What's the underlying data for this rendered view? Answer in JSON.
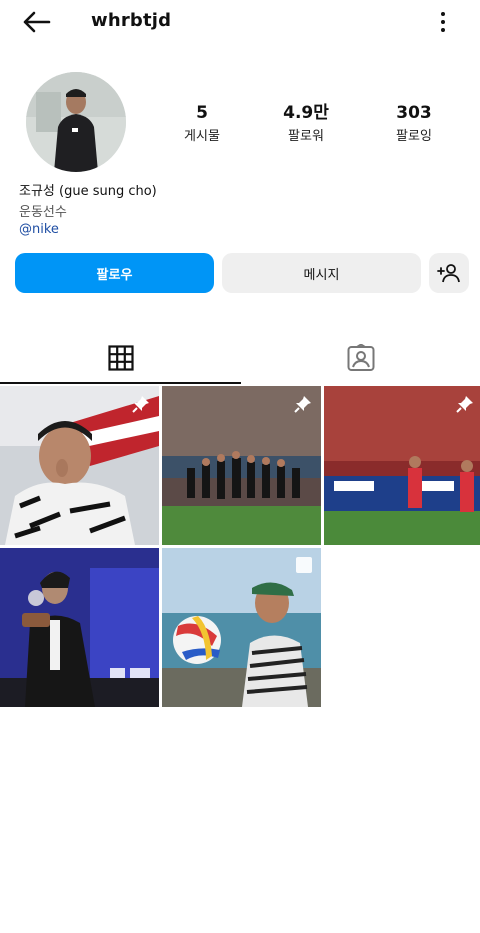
{
  "header": {
    "username": "whrbtjd",
    "back_icon": "arrow-left-icon",
    "more_icon": "more-vertical-icon"
  },
  "profile": {
    "stats": [
      {
        "value": "5",
        "label": "게시물"
      },
      {
        "value": "4.9만",
        "label": "팔로워"
      },
      {
        "value": "303",
        "label": "팔로잉"
      }
    ],
    "name": "조규성 (gue sung cho)",
    "category": "운동선수",
    "tag": "@nike"
  },
  "actions": {
    "follow_label": "팔로우",
    "message_label": "메시지",
    "add_user_icon": "add-person-icon"
  },
  "tabs": [
    {
      "icon": "grid-icon",
      "active": true
    },
    {
      "icon": "tagged-person-icon",
      "active": false
    }
  ],
  "colors": {
    "accent": "#0095f6",
    "secondary_button": "#efefef",
    "link": "#1f4ea3"
  },
  "posts": [
    {
      "pinned": true,
      "icon": "pin-icon"
    },
    {
      "pinned": true,
      "icon": "pin-icon"
    },
    {
      "pinned": true,
      "icon": "pin-icon"
    },
    {
      "pinned": false
    },
    {
      "pinned": false,
      "icon": "multiple-images-icon"
    }
  ]
}
